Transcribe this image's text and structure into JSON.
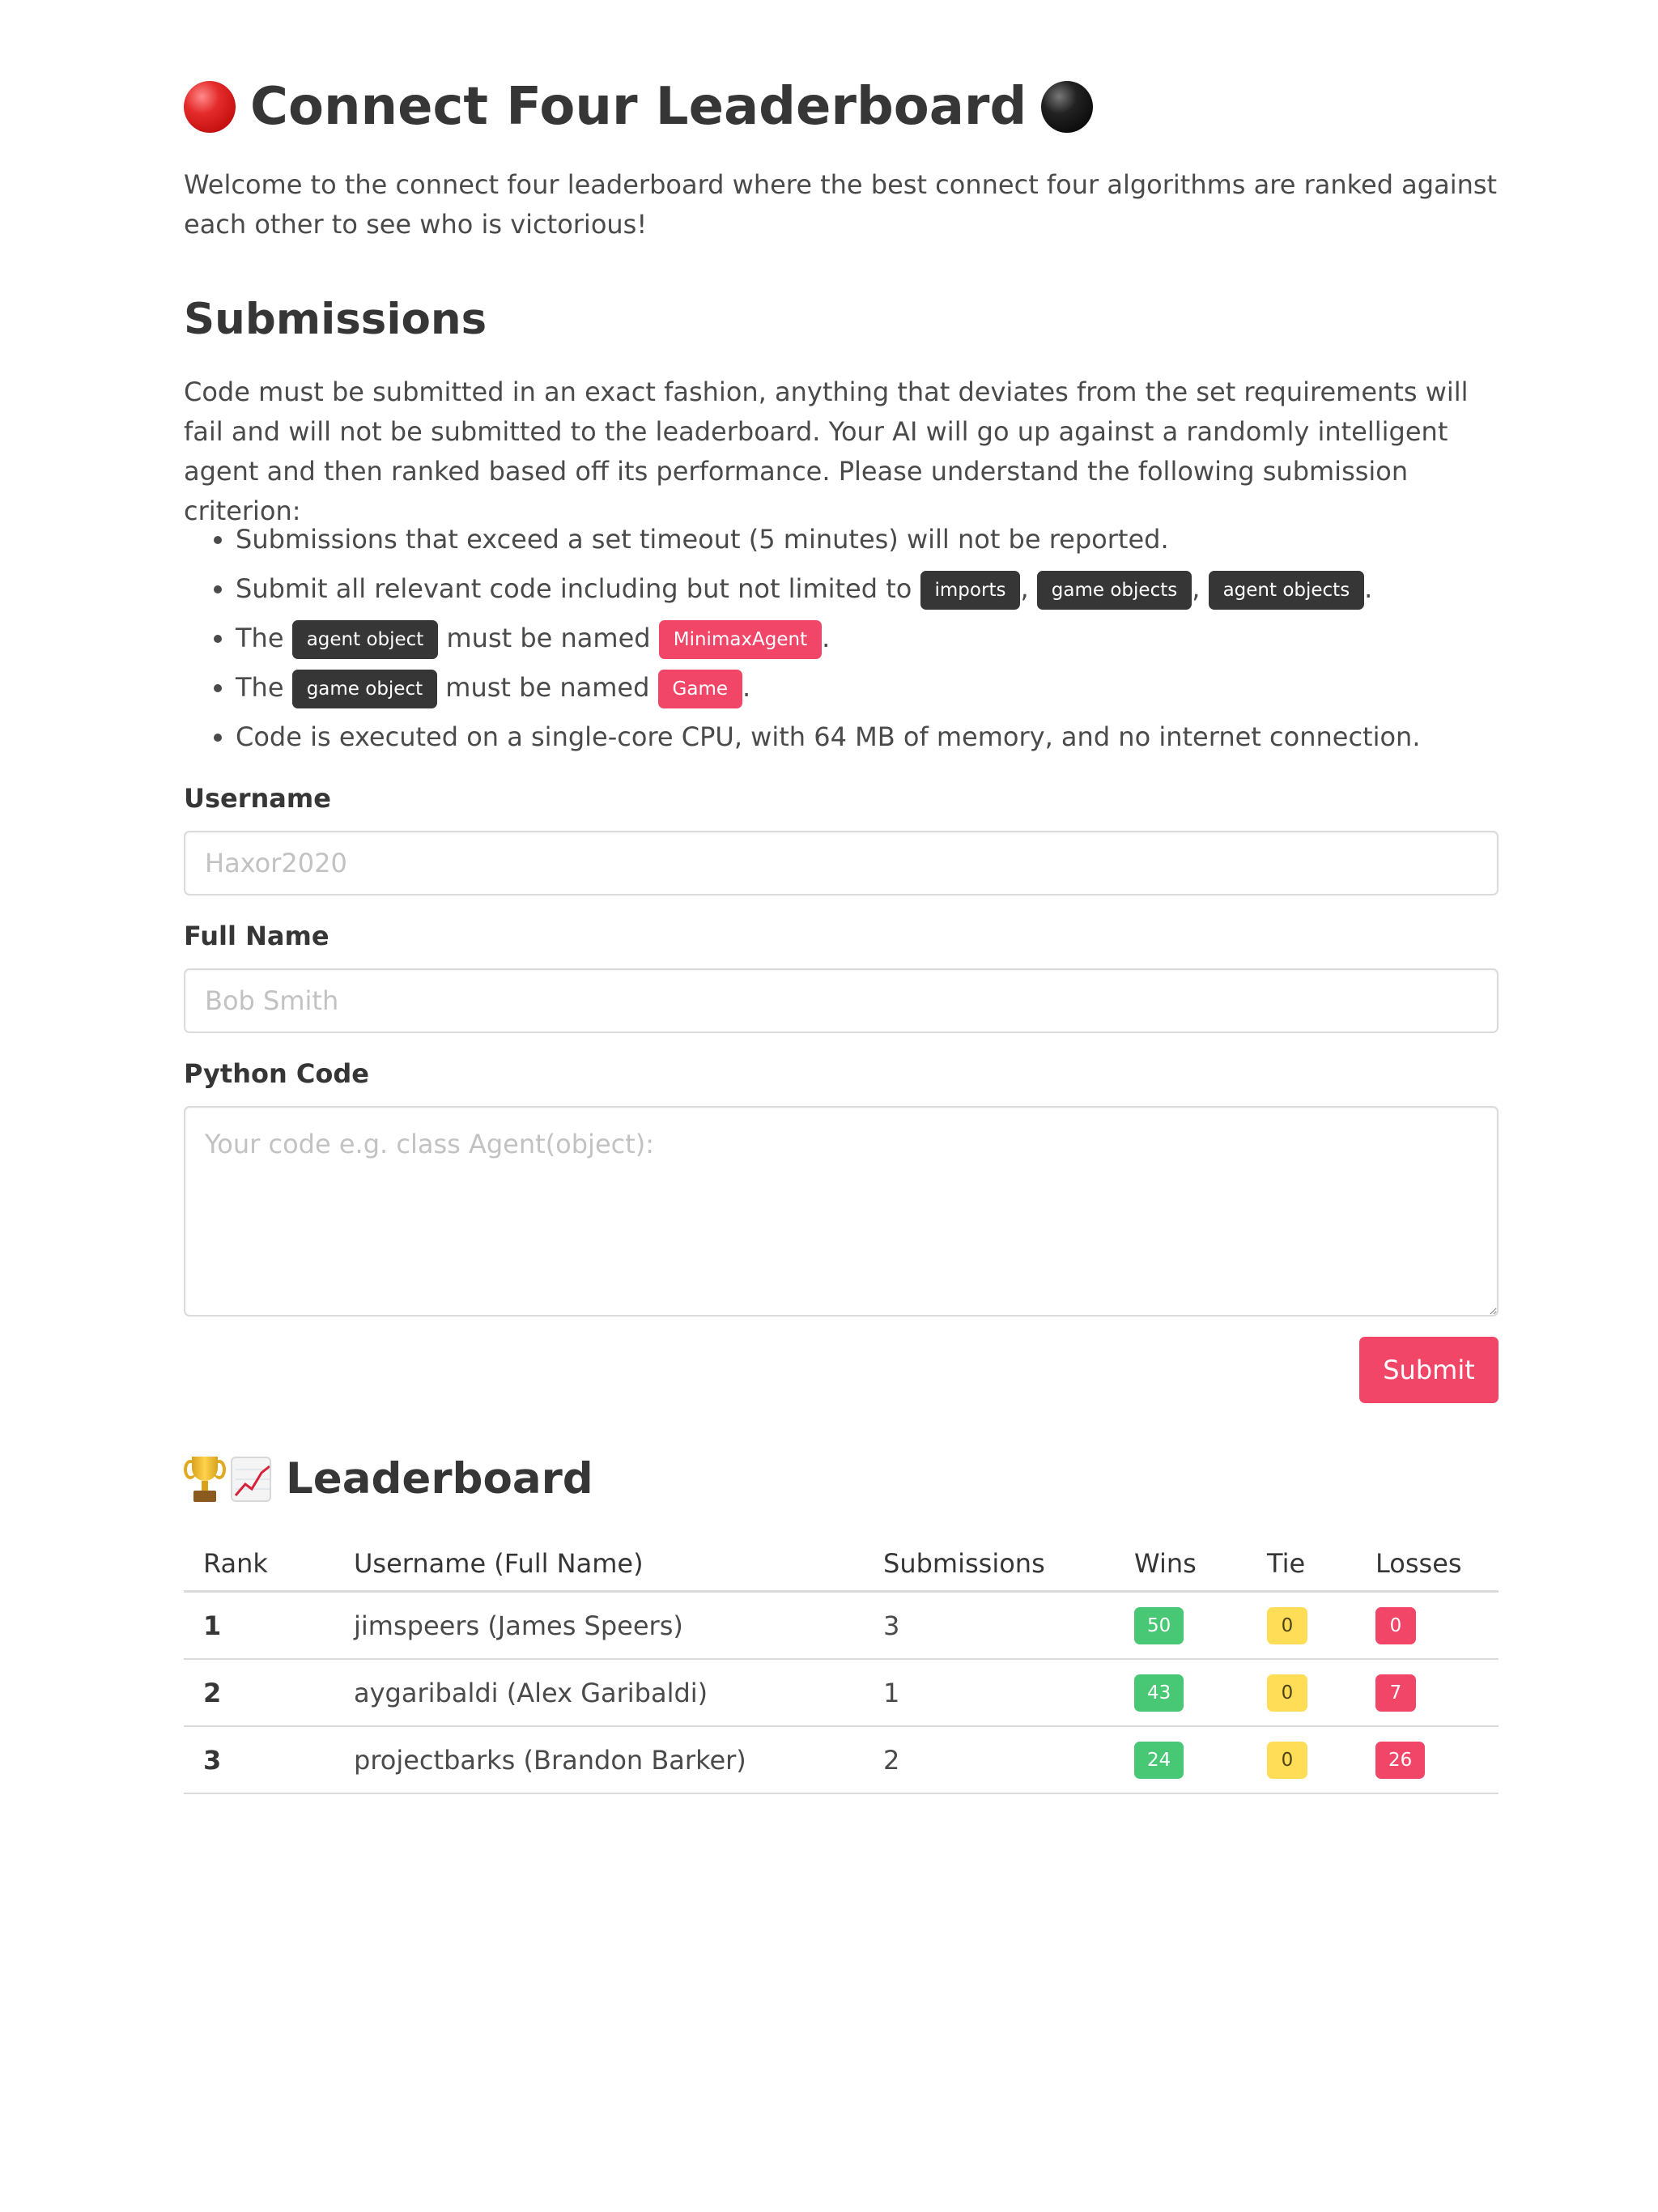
{
  "page": {
    "title": "Connect Four Leaderboard",
    "title_icon_left": "red-disc-icon",
    "title_icon_right": "black-disc-icon",
    "intro": "Welcome to the connect four leaderboard where the best connect four algorithms are ranked against each other to see who is victorious!"
  },
  "submissions": {
    "heading": "Submissions",
    "description": "Code must be submitted in an exact fashion, anything that deviates from the set requirements will fail and will not be submitted to the leaderboard. Your AI will go up against a randomly intelligent agent and then ranked based off its performance. Please understand the following submission criterion:",
    "criteria": {
      "item1": "Submissions that exceed a set timeout (5 minutes) will not be reported.",
      "item2_prefix": "Submit all relevant code including but not limited to",
      "item2_tags": [
        "imports",
        "game objects",
        "agent objects"
      ],
      "item3_prefix": "The",
      "item3_tag": "agent object",
      "item3_middle": "must be named",
      "item3_name": "MinimaxAgent",
      "item4_prefix": "The",
      "item4_tag": "game object",
      "item4_middle": "must be named",
      "item4_name": "Game",
      "item5": "Code is executed on a single-core CPU, with 64 MB of memory, and no internet connection."
    },
    "form": {
      "username_label": "Username",
      "username_placeholder": "Haxor2020",
      "username_value": "",
      "fullname_label": "Full Name",
      "fullname_placeholder": "Bob Smith",
      "fullname_value": "",
      "code_label": "Python Code",
      "code_placeholder": "Your code e.g. class Agent(object):",
      "code_value": "",
      "submit_label": "Submit"
    }
  },
  "leaderboard": {
    "heading": "Leaderboard",
    "heading_icons": [
      "trophy-icon",
      "chart-increasing-icon"
    ],
    "columns": [
      "Rank",
      "Username (Full Name)",
      "Submissions",
      "Wins",
      "Tie",
      "Losses"
    ],
    "rows": [
      {
        "rank": "1",
        "user": "jimspeers (James Speers)",
        "submissions": "3",
        "wins": "50",
        "tie": "0",
        "losses": "0"
      },
      {
        "rank": "2",
        "user": "aygaribaldi (Alex Garibaldi)",
        "submissions": "1",
        "wins": "43",
        "tie": "0",
        "losses": "7"
      },
      {
        "rank": "3",
        "user": "projectbarks (Brandon Barker)",
        "submissions": "2",
        "wins": "24",
        "tie": "0",
        "losses": "26"
      }
    ]
  },
  "colors": {
    "accent": "#f14668",
    "dark_tag": "#363636",
    "wins": "#48c774",
    "tie": "#ffdd57",
    "losses": "#f14668"
  }
}
